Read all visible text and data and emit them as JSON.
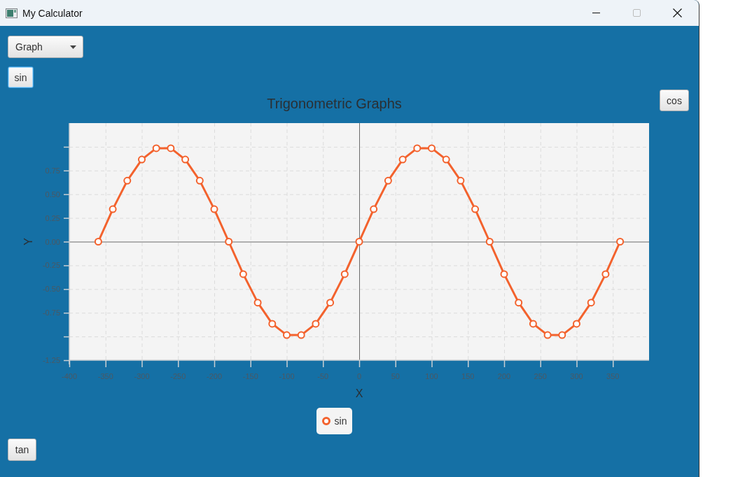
{
  "window": {
    "title": "My Calculator",
    "controls": [
      {
        "kind": "minimize",
        "disabled": false
      },
      {
        "kind": "maximize",
        "disabled": true
      },
      {
        "kind": "close",
        "disabled": false
      }
    ]
  },
  "mode_dropdown": {
    "value": "Graph"
  },
  "top_button": {
    "label": "sin",
    "focused": true
  },
  "side_button": {
    "label": "cos",
    "focused": false
  },
  "chart": {
    "chart_data": {
      "type": "line",
      "title": "Trigonometric Graphs",
      "xlabel": "X",
      "ylabel": "Y",
      "grid": true,
      "x": [
        -360,
        -340,
        -320,
        -300,
        -280,
        -260,
        -240,
        -220,
        -200,
        -180,
        -160,
        -140,
        -120,
        -100,
        -80,
        -60,
        -40,
        -20,
        0,
        20,
        40,
        60,
        80,
        100,
        120,
        140,
        160,
        180,
        200,
        220,
        240,
        260,
        280,
        300,
        320,
        340,
        360
      ],
      "series": [
        {
          "name": "sin",
          "color": "#f3622d",
          "marker": "circle",
          "values": [
            0,
            0.342,
            0.643,
            0.866,
            0.985,
            0.985,
            0.866,
            0.643,
            0.342,
            0,
            -0.342,
            -0.643,
            -0.866,
            -0.985,
            -0.985,
            -0.866,
            -0.643,
            -0.342,
            0,
            0.342,
            0.643,
            0.866,
            0.985,
            0.985,
            0.866,
            0.643,
            0.342,
            0,
            -0.342,
            -0.643,
            -0.866,
            -0.985,
            -0.985,
            -0.866,
            -0.643,
            -0.342,
            0
          ]
        }
      ],
      "xlim": [
        -400,
        400
      ],
      "ylim": [
        -1.25,
        1.25
      ],
      "xticks": [
        -400,
        -350,
        -300,
        -250,
        -200,
        -150,
        -100,
        -50,
        0,
        50,
        100,
        150,
        200,
        250,
        300,
        350
      ],
      "yticks": [
        {
          "value": -1.25,
          "label": "-1.25"
        },
        {
          "value": -0.75,
          "label": "-0.75"
        },
        {
          "value": -0.5,
          "label": "-0.50"
        },
        {
          "value": -0.25,
          "label": "-0.25"
        },
        {
          "value": 0,
          "label": "0.00"
        },
        {
          "value": 0.25,
          "label": "0.25"
        },
        {
          "value": 0.5,
          "label": "0.50"
        },
        {
          "value": 0.75,
          "label": "0.75"
        }
      ]
    }
  },
  "bottom_button": {
    "label": "tan",
    "focused": false
  }
}
